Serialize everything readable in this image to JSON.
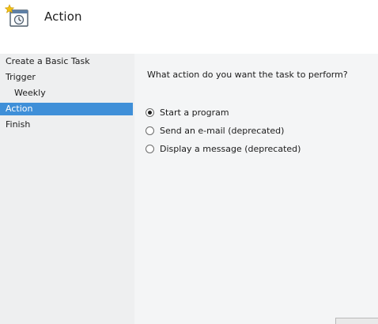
{
  "header": {
    "title": "Action",
    "icon": "task-scheduler-icon"
  },
  "sidebar": {
    "items": [
      {
        "label": "Create a Basic Task",
        "selected": false
      },
      {
        "label": "Trigger",
        "selected": false
      },
      {
        "label": "Weekly",
        "selected": false
      },
      {
        "label": "Action",
        "selected": true
      },
      {
        "label": "Finish",
        "selected": false
      }
    ]
  },
  "main": {
    "question": "What action do you want the task to perform?",
    "options": [
      {
        "label": "Start a program",
        "checked": true
      },
      {
        "label": "Send an e-mail (deprecated)",
        "checked": false
      },
      {
        "label": "Display a message (deprecated)",
        "checked": false
      }
    ]
  },
  "colors": {
    "selection": "#3f8fd8",
    "background": "#f4f5f6"
  }
}
